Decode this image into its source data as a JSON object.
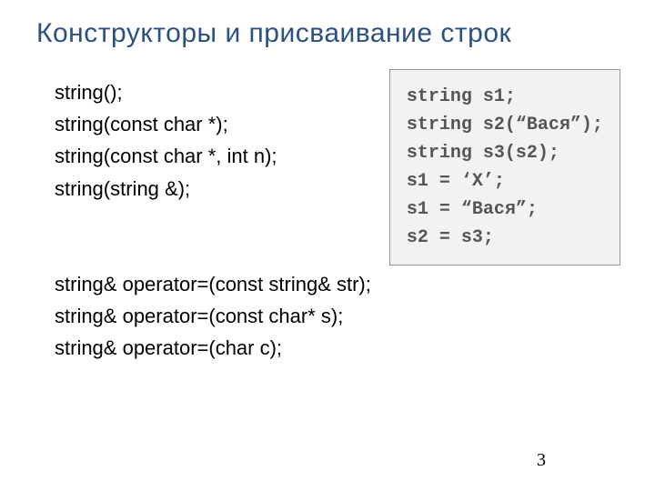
{
  "title": "Конструкторы и присваивание строк",
  "signatures_top": [
    "string();",
    "string(const char *);",
    "string(const char *, int n);",
    "string(string &);"
  ],
  "signatures_bottom": [
    "string& operator=(const string& str);",
    "string& operator=(const char* s);",
    "string& operator=(char c);"
  ],
  "code": [
    "string s1;",
    "string s2(“Вася”);",
    "string s3(s2);",
    "s1 = ‘X’;",
    "s1 = “Вася”;",
    "s2 = s3;"
  ],
  "page_number": "3"
}
